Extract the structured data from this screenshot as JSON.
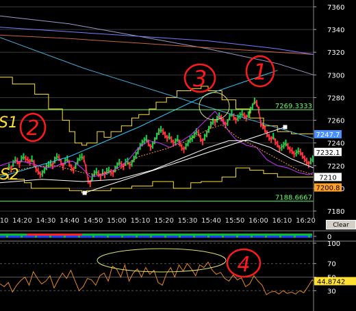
{
  "chart_data": [
    {
      "type": "line",
      "title": "",
      "xlabel": "",
      "ylabel": "",
      "x_ticks": [
        "14:10",
        "14:20",
        "14:30",
        "14:40",
        "14:50",
        "15:00",
        "15:10",
        "15:20",
        "15:30",
        "15:40",
        "15:50",
        "16:00",
        "16:10",
        "16:20"
      ],
      "y_ticks": [
        7180,
        7200,
        7220,
        7240,
        7260,
        7280,
        7300,
        7320,
        7340,
        7360
      ],
      "ylim": [
        7174,
        7366
      ],
      "grid": true,
      "series": [
        {
          "role": "price",
          "color": "#ff2d5a",
          "x": [
            10,
            13,
            16,
            19,
            22,
            25,
            28,
            31,
            34,
            37,
            40,
            43,
            46,
            49,
            52,
            55,
            58,
            61,
            64,
            67,
            70,
            73,
            76,
            79,
            82,
            85,
            88,
            91,
            94,
            97,
            100,
            103,
            106,
            109,
            112,
            115,
            118,
            121,
            124,
            127,
            130,
            133,
            136,
            139,
            142,
            145,
            148,
            151,
            154,
            157,
            160,
            163,
            166,
            169,
            172,
            175,
            178,
            181,
            184,
            187,
            190,
            193,
            196,
            199,
            202,
            205,
            208,
            211,
            214,
            217,
            220,
            223,
            226,
            229,
            232,
            235,
            238,
            241,
            244,
            247,
            250,
            253,
            256,
            259,
            262,
            265,
            268,
            271,
            274,
            277,
            280,
            283,
            286,
            289,
            292,
            295,
            298,
            301,
            304,
            307,
            310,
            313,
            316,
            319,
            322,
            325,
            328,
            331,
            334,
            337,
            340,
            343,
            346,
            349,
            352,
            355,
            358,
            361,
            364,
            367,
            370,
            373,
            376,
            379,
            382,
            385,
            388,
            391,
            394,
            397,
            400,
            403,
            406,
            409,
            412,
            415,
            418,
            421,
            424,
            427,
            430,
            433,
            436,
            439,
            442,
            445,
            448,
            451
          ],
          "values": [
            7218,
            7219,
            7217,
            7222,
            7225,
            7224,
            7221,
            7226,
            7228,
            7226,
            7225,
            7223,
            7226,
            7222,
            7217,
            7215,
            7212,
            7213,
            7216,
            7219,
            7221,
            7222,
            7220,
            7225,
            7228,
            7227,
            7223,
            7219,
            7224,
            7226,
            7222,
            7218,
            7216,
            7220,
            7224,
            7227,
            7228,
            7226,
            7218,
            7207,
            7204,
            7210,
            7213,
            7215,
            7213,
            7210,
            7214,
            7212,
            7215,
            7216,
            7214,
            7213,
            7217,
            7220,
            7223,
            7221,
            7219,
            7223,
            7224,
            7220,
            7222,
            7226,
            7229,
            7233,
            7237,
            7240,
            7242,
            7244,
            7240,
            7236,
            7238,
            7242,
            7246,
            7250,
            7252,
            7250,
            7247,
            7244,
            7246,
            7243,
            7240,
            7241,
            7244,
            7240,
            7236,
            7234,
            7237,
            7240,
            7243,
            7244,
            7247,
            7250,
            7249,
            7244,
            7241,
            7245,
            7248,
            7252,
            7256,
            7259,
            7258,
            7261,
            7264,
            7262,
            7259,
            7256,
            7258,
            7263,
            7266,
            7263,
            7260,
            7262,
            7264,
            7266,
            7264,
            7262,
            7265,
            7269,
            7272,
            7277,
            7275,
            7269,
            7257,
            7255,
            7252,
            7248,
            7245,
            7243,
            7246,
            7241,
            7239,
            7235,
            7236,
            7238,
            7240,
            7237,
            7234,
            7233,
            7230,
            7231,
            7233,
            7232,
            7229,
            7226,
            7224,
            7221,
            7224,
            7226
          ]
        },
        {
          "role": "ma-fast",
          "color": "#cc33ff",
          "x": [
            0,
            15,
            30,
            45,
            60,
            75,
            90,
            105,
            118,
            130,
            150,
            170,
            185,
            200,
            215,
            230,
            245,
            260,
            275,
            290,
            300,
            310,
            320,
            330,
            340,
            355,
            370,
            385,
            400,
            415,
            430,
            445,
            452
          ],
          "values": [
            7220,
            7223,
            7224,
            7222,
            7219,
            7218,
            7222,
            7224,
            7218,
            7210,
            7212,
            7218,
            7225,
            7236,
            7242,
            7240,
            7236,
            7241,
            7247,
            7256,
            7262,
            7268,
            7260,
            7250,
            7243,
            7238,
            7236,
            7225,
            7220,
            7218,
            7214,
            7212,
            7214
          ]
        },
        {
          "role": "ma-medium",
          "color": "#ffa028",
          "dash": "2,2",
          "x": [
            0,
            40,
            80,
            118,
            140,
            170,
            200,
            240,
            270,
            300,
            320,
            340,
            370,
            400,
            430,
            452
          ],
          "values": [
            7212,
            7218,
            7220,
            7214,
            7212,
            7216,
            7228,
            7235,
            7242,
            7252,
            7256,
            7246,
            7236,
            7226,
            7216,
            7212
          ]
        },
        {
          "role": "ma-slow",
          "color": "#ffffff",
          "x": [
            0,
            60,
            120,
            170,
            220,
            260,
            300,
            330,
            360,
            390,
            420,
            452
          ],
          "values": [
            7205,
            7208,
            7206,
            7208,
            7216,
            7226,
            7236,
            7242,
            7242,
            7236,
            7226,
            7218
          ]
        },
        {
          "role": "band-upper",
          "color": "#ffe033",
          "x": [
            0,
            18,
            18,
            50,
            50,
            70,
            70,
            90,
            90,
            100,
            100,
            108,
            108,
            118,
            118,
            125,
            125,
            140,
            140,
            150,
            150,
            160,
            160,
            175,
            175,
            190,
            190,
            200,
            200,
            215,
            215,
            225,
            225,
            240,
            240,
            255,
            255,
            275,
            275,
            290,
            290,
            300,
            300,
            320,
            320,
            340,
            340,
            360,
            360,
            380,
            380,
            400,
            400,
            420,
            420,
            452
          ],
          "values": [
            7298,
            7298,
            7292,
            7292,
            7283,
            7283,
            7270,
            7270,
            7260,
            7260,
            7250,
            7250,
            7240,
            7240,
            7238,
            7238,
            7240,
            7240,
            7250,
            7250,
            7245,
            7245,
            7250,
            7250,
            7255,
            7255,
            7262,
            7262,
            7265,
            7265,
            7270,
            7270,
            7276,
            7276,
            7280,
            7280,
            7286,
            7286,
            7288,
            7288,
            7290,
            7290,
            7286,
            7286,
            7278,
            7278,
            7270,
            7270,
            7262,
            7262,
            7255,
            7255,
            7250,
            7250,
            7248,
            7248
          ]
        },
        {
          "role": "band-lower",
          "color": "#ffe033",
          "x": [
            0,
            12,
            12,
            35,
            35,
            45,
            45,
            100,
            100,
            118,
            118,
            125,
            125,
            160,
            160,
            190,
            190,
            220,
            220,
            250,
            250,
            275,
            275,
            290,
            290,
            320,
            320,
            340,
            340,
            360,
            360,
            380,
            380,
            400,
            400,
            452
          ],
          "values": [
            7212,
            7212,
            7208,
            7208,
            7205,
            7205,
            7200,
            7200,
            7198,
            7198,
            7196,
            7196,
            7198,
            7198,
            7200,
            7200,
            7202,
            7202,
            7206,
            7206,
            7200,
            7200,
            7205,
            7205,
            7206,
            7206,
            7210,
            7210,
            7218,
            7218,
            7216,
            7216,
            7213,
            7213,
            7210,
            7210
          ]
        },
        {
          "role": "long-ma-1",
          "color": "#9a9acb",
          "x": [
            0,
            100,
            200,
            300,
            400,
            452
          ],
          "values": [
            7352,
            7345,
            7334,
            7323,
            7310,
            7300
          ]
        },
        {
          "role": "long-ma-2",
          "color": "#c8643c",
          "x": [
            0,
            100,
            200,
            300,
            400,
            452
          ],
          "values": [
            7335,
            7332,
            7328,
            7324,
            7320,
            7318
          ]
        },
        {
          "role": "long-ma-3",
          "color": "#7c7cff",
          "x": [
            0,
            100,
            200,
            300,
            400,
            452
          ],
          "values": [
            7342,
            7338,
            7334,
            7330,
            7323,
            7318
          ]
        },
        {
          "role": "slope-line",
          "color": "#4aa8d8",
          "x": [
            0,
            120,
            240,
            330,
            452
          ],
          "values": [
            7333,
            7306,
            7283,
            7266,
            7244
          ]
        },
        {
          "role": "trend-line",
          "color": "#31c8ff",
          "x": [
            0,
            100,
            200,
            300,
            400
          ],
          "values": [
            7210,
            7228,
            7254,
            7283,
            7304
          ]
        }
      ],
      "horizontal_lines": [
        {
          "label": "7269.3333",
          "value": 7269.3333,
          "color": "#66ff66"
        },
        {
          "label": "7188.6667",
          "value": 7188.6667,
          "color": "#66ff66"
        }
      ],
      "price_labels": [
        {
          "label": "7247.7",
          "value": 7247.7,
          "color": "#4a90ff",
          "text_color": "#ffffff"
        },
        {
          "label": "7232.1",
          "value": 7232.1,
          "color": "#ffffff",
          "text_color": "#000000"
        },
        {
          "label": "7210",
          "value": 7210,
          "color": "#ffffff",
          "text_color": "#000000"
        },
        {
          "label": "7200.8",
          "value": 7200.8,
          "color": "#ffa028",
          "text_color": "#000000"
        }
      ],
      "trendline_points": [
        {
          "x": 122,
          "value": 7196
        },
        {
          "x": 411,
          "value": 7254
        }
      ],
      "annotations": [
        "3",
        "1",
        "S1",
        "2",
        "S2"
      ]
    },
    {
      "type": "bar",
      "role": "direction-strip",
      "y_ticks": [
        "0"
      ],
      "colors": {
        "up": "#00c030",
        "down": "#ff2020",
        "neutral": "#2040ff"
      }
    },
    {
      "type": "line",
      "title": "",
      "xlabel": "",
      "ylabel": "",
      "ylim": [
        0,
        100
      ],
      "y_ticks": [
        100,
        70,
        50,
        30
      ],
      "grid": true,
      "x_ticks": [
        "14:10",
        "14:20",
        "14:30",
        "14:40",
        "14:50",
        "15:00",
        "15:10",
        "15:20",
        "15:30",
        "15:40",
        "15:50",
        "16:00",
        "16:10",
        "16:20"
      ],
      "series": [
        {
          "role": "oscillator",
          "color": "#e68a1e",
          "x": [
            0,
            6,
            12,
            18,
            24,
            30,
            36,
            42,
            48,
            54,
            60,
            66,
            72,
            78,
            84,
            90,
            96,
            102,
            108,
            114,
            120,
            126,
            132,
            138,
            144,
            150,
            156,
            162,
            168,
            174,
            180,
            186,
            192,
            198,
            204,
            210,
            216,
            222,
            228,
            234,
            240,
            246,
            252,
            258,
            264,
            270,
            276,
            282,
            288,
            294,
            300,
            306,
            312,
            318,
            324,
            330,
            336,
            342,
            348,
            354,
            360,
            366,
            372,
            378,
            384,
            390,
            396,
            402,
            408,
            414,
            420,
            426,
            432,
            438,
            444,
            450,
            452
          ],
          "values": [
            40,
            36,
            42,
            28,
            38,
            45,
            50,
            38,
            58,
            48,
            40,
            44,
            52,
            34,
            46,
            56,
            48,
            60,
            45,
            30,
            36,
            48,
            46,
            38,
            52,
            56,
            44,
            66,
            62,
            50,
            68,
            44,
            56,
            62,
            50,
            64,
            54,
            60,
            42,
            38,
            55,
            64,
            50,
            68,
            59,
            70,
            62,
            52,
            68,
            64,
            72,
            60,
            54,
            57,
            48,
            44,
            53,
            46,
            49,
            36,
            40,
            52,
            44,
            38,
            24,
            28,
            29,
            25,
            30,
            26,
            28,
            25,
            30,
            27,
            36,
            46,
            44
          ]
        }
      ],
      "value_label": "44.8742",
      "annotations": [
        "4"
      ]
    }
  ],
  "ui": {
    "clear_lines_label": "Clear Lines"
  }
}
